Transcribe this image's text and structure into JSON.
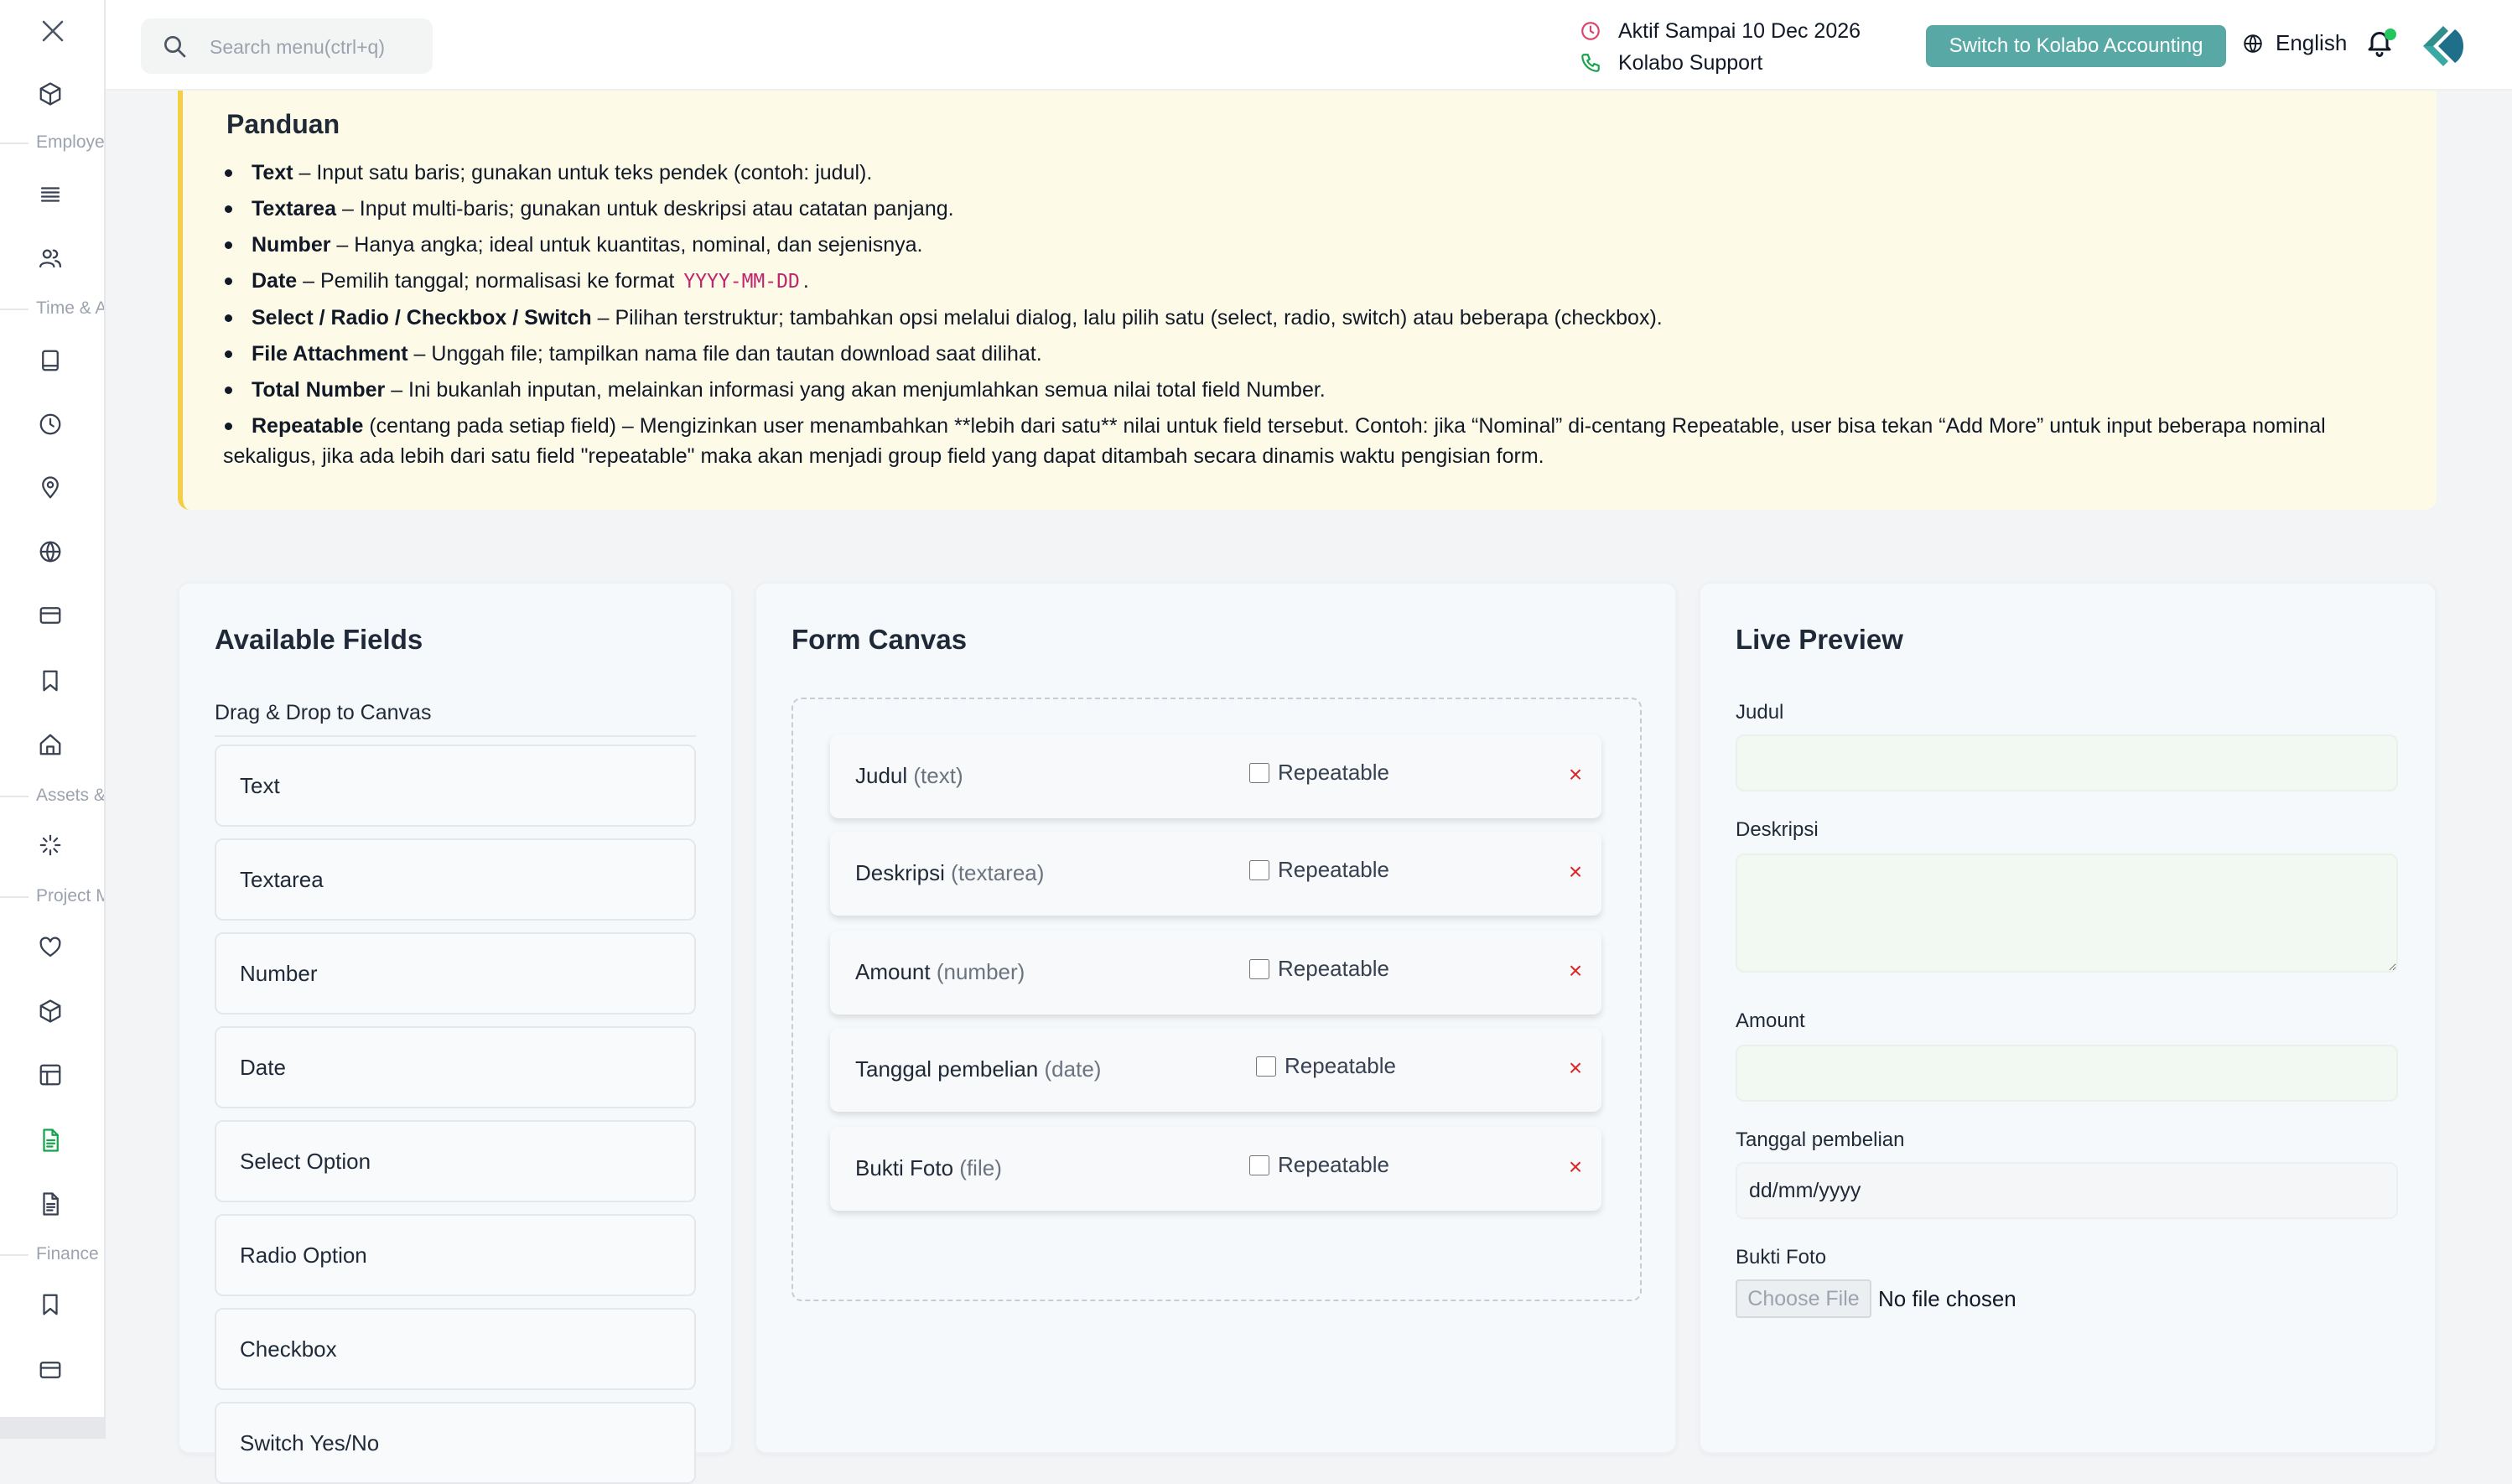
{
  "topbar": {
    "search_placeholder": "Search menu(ctrl+q)",
    "active_until": "Aktif Sampai 10 Dec 2026",
    "support": "Kolabo Support",
    "switch_button": "Switch to Kolabo Accounting",
    "language": "English"
  },
  "sidebar": {
    "sections": [
      "Employe",
      "Time & A",
      "Assets &",
      "Project M",
      "Finance"
    ]
  },
  "guide": {
    "title": "Panduan",
    "items": [
      {
        "term": "Text",
        "desc": " – Input satu baris; gunakan untuk teks pendek (contoh: judul)."
      },
      {
        "term": "Textarea",
        "desc": " – Input multi-baris; gunakan untuk deskripsi atau catatan panjang."
      },
      {
        "term": "Number",
        "desc": " – Hanya angka; ideal untuk kuantitas, nominal, dan sejenisnya."
      },
      {
        "term": "Date",
        "desc": " – Pemilih tanggal; normalisasi ke format ",
        "code": "YYYY-MM-DD",
        "tail": "."
      },
      {
        "term": "Select / Radio / Checkbox / Switch",
        "desc": " – Pilihan terstruktur; tambahkan opsi melalui dialog, lalu pilih satu (select, radio, switch) atau beberapa (checkbox)."
      },
      {
        "term": "File Attachment",
        "desc": " – Unggah file; tampilkan nama file dan tautan download saat dilihat."
      },
      {
        "term": "Total Number",
        "desc": " – Ini bukanlah inputan, melainkan informasi yang akan menjumlahkan semua nilai total field Number."
      },
      {
        "term": "Repeatable",
        "desc": " (centang pada setiap field) – Mengizinkan user menambahkan **lebih dari satu** nilai untuk field tersebut. Contoh: jika “Nominal” di-centang Repeatable, user bisa tekan “Add More” untuk input beberapa nominal sekaligus, jika ada lebih dari satu field \"repeatable\" maka akan menjadi group field yang dapat ditambah secara dinamis waktu pengisian form."
      }
    ]
  },
  "available": {
    "title": "Available Fields",
    "subtitle": "Drag & Drop to Canvas",
    "fields": [
      "Text",
      "Textarea",
      "Number",
      "Date",
      "Select Option",
      "Radio Option",
      "Checkbox",
      "Switch Yes/No"
    ]
  },
  "canvas": {
    "title": "Form Canvas",
    "repeatable_label": "Repeatable",
    "remove_symbol": "×",
    "items": [
      {
        "label": "Judul",
        "type": "(text)",
        "repeatable": false
      },
      {
        "label": "Deskripsi",
        "type": "(textarea)",
        "repeatable": false
      },
      {
        "label": "Amount",
        "type": "(number)",
        "repeatable": false
      },
      {
        "label": "Tanggal pembelian",
        "type": "(date)",
        "repeatable": false
      },
      {
        "label": "Bukti Foto",
        "type": "(file)",
        "repeatable": false
      }
    ]
  },
  "preview": {
    "title": "Live Preview",
    "fields": [
      {
        "label": "Judul"
      },
      {
        "label": "Deskripsi"
      },
      {
        "label": "Amount"
      },
      {
        "label": "Tanggal pembelian",
        "placeholder": "dd/mm/yyyy"
      },
      {
        "label": "Bukti Foto",
        "button": "Choose File",
        "status": "No file chosen"
      }
    ]
  },
  "colors": {
    "accent": "#58a9a6",
    "guide_bg": "#fdfbe7",
    "guide_border": "#f4cf45",
    "remove": "#dc2626",
    "active_nav": "#16a34a"
  }
}
